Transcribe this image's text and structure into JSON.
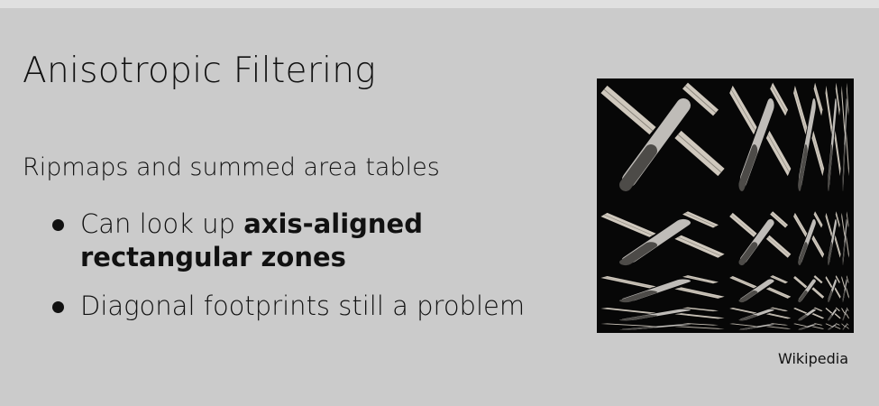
{
  "slide": {
    "title": "Anisotropic Filtering",
    "subtitle": "Ripmaps and summed area tables",
    "bullets": [
      {
        "prefix": "Can look up ",
        "bold": "axis-aligned rectangular zones"
      },
      {
        "text": "Diagonal footprints still a problem"
      }
    ],
    "image": {
      "description_icon": "satellite-ripmap-image",
      "credit": "Wikipedia"
    }
  }
}
